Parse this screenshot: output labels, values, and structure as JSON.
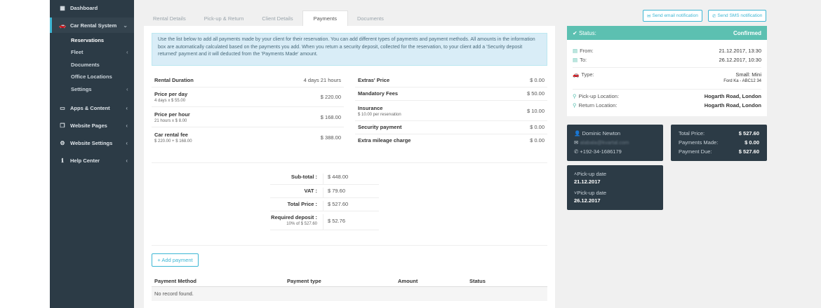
{
  "sidebar": {
    "dashboard": "Dashboard",
    "car_rental": "Car Rental System",
    "sub": [
      "Reservations",
      "Fleet",
      "Documents",
      "Office Locations",
      "Settings"
    ],
    "apps": "Apps & Content",
    "website_pages": "Website Pages",
    "website_settings": "Website Settings",
    "help": "Help Center"
  },
  "tabs": [
    "Rental Details",
    "Pick-up & Return",
    "Client Details",
    "Payments",
    "Documents"
  ],
  "actions": {
    "email": "Send email notification",
    "sms": "Send SMS notification"
  },
  "info_text": "Use the list below to add all payments made by your client for their reservation. You can add different types of payments and payment methods. All amounts in the information box are automatically calculated based on the payments you add. When you return a security deposit, collected for the reservation, to your client add a 'Security deposit returned' payment and it will deducted from the 'Payments Made' amount.",
  "left_rows": [
    {
      "label": "Rental Duration",
      "sub": "",
      "value": "4 days 21 hours"
    },
    {
      "label": "Price per day",
      "sub": "4 days x $ 55.00",
      "value": "$ 220.00"
    },
    {
      "label": "Price per hour",
      "sub": "21 hours x $ 8.00",
      "value": "$ 168.00"
    },
    {
      "label": "Car rental fee",
      "sub": "$ 220.00 + $ 168.00",
      "value": "$ 388.00"
    }
  ],
  "right_rows": [
    {
      "label": "Extras' Price",
      "sub": "",
      "value": "$ 0.00"
    },
    {
      "label": "Mandatory Fees",
      "sub": "",
      "value": "$ 50.00"
    },
    {
      "label": "Insurance",
      "sub": "$ 10.00 per reservation",
      "value": "$ 10.00"
    },
    {
      "label": "Security payment",
      "sub": "",
      "value": "$ 0.00"
    },
    {
      "label": "Extra mileage charge",
      "sub": "",
      "value": "$ 0.00"
    }
  ],
  "totals": [
    {
      "label": "Sub-total :",
      "sub": "",
      "value": "$ 448.00"
    },
    {
      "label": "VAT :",
      "sub": "",
      "value": "$ 79.60"
    },
    {
      "label": "Total Price :",
      "sub": "",
      "value": "$ 527.60"
    },
    {
      "label": "Required deposit :",
      "sub": "10% of $ 527.60",
      "value": "$ 52.76"
    }
  ],
  "add_payment": "+ Add payment",
  "table": {
    "headers": [
      "Payment Method",
      "Payment type",
      "Amount",
      "Status"
    ],
    "empty": "No record found."
  },
  "status": {
    "label": "Status:",
    "value": "Confirmed",
    "from_label": "From:",
    "from_value": "21.12.2017, 13:30",
    "to_label": "To:",
    "to_value": "26.12.2017, 10:30",
    "type_label": "Type:",
    "type_value": "Small: Mini",
    "type_sub": "Ford Ka - ABC12 34",
    "pickup_label": "Pick-up Location:",
    "pickup_value": "Hogarth Road, London",
    "return_label": "Return Location:",
    "return_value": "Hogarth Road, London"
  },
  "client": {
    "name": "Dominic Newton",
    "email": "alabala@kvartal.com",
    "phone": "+192-34-1686179"
  },
  "payment_summary": {
    "total_label": "Total Price:",
    "total_value": "$ 527.60",
    "made_label": "Payments Made:",
    "made_value": "$ 0.00",
    "due_label": "Payment Due:",
    "due_value": "$ 527.60"
  },
  "dates": {
    "pickup_label": "Pick-up date",
    "pickup_value": "21.12.2017",
    "return_label": "Pick-up date",
    "return_value": "26.12.2017"
  },
  "colors": {
    "accent": "#3db6d4",
    "status": "#5cc0b1",
    "sidebar": "#2c3b46"
  }
}
